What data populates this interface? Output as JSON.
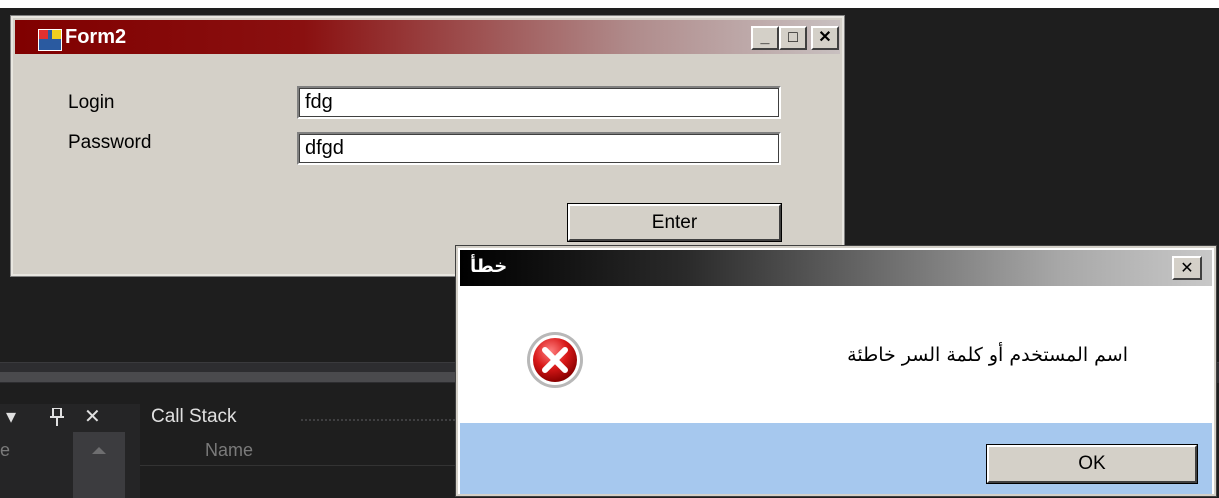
{
  "form2": {
    "title": "Form2",
    "login_label": "Login",
    "login_value": "fdg",
    "password_label": "Password",
    "password_value": "dfgd",
    "enter_label": "Enter",
    "minimize_glyph": "_",
    "maximize_glyph": "□",
    "close_glyph": "✕"
  },
  "dialog": {
    "title": "خطأ",
    "message": "اسم المستخدم أو كلمة السر خاطئة",
    "ok_label": "OK",
    "close_glyph": "✕",
    "icon": "error-icon"
  },
  "ide": {
    "left_pane_title": "e",
    "callstack_title": "Call Stack",
    "column_name": "Name",
    "dropdown_glyph": "▾",
    "pin_glyph": "ᵖ",
    "close_glyph": "✕"
  },
  "colors": {
    "form_titlebar": "#800000",
    "dialog_footer": "#a6c8ee",
    "ide_background": "#1e1e1e"
  }
}
